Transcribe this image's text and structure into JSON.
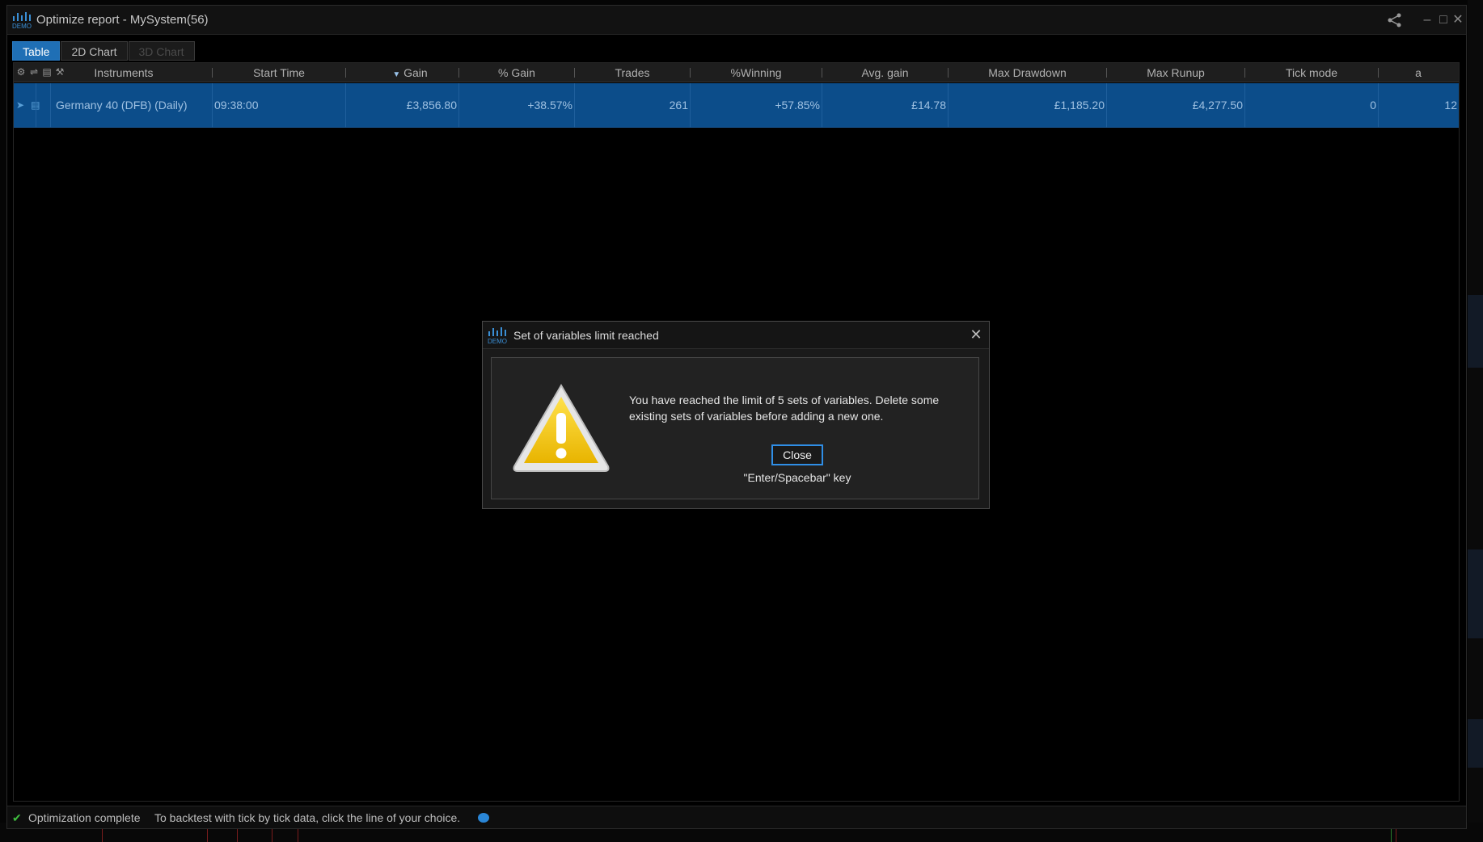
{
  "window": {
    "title": "Optimize report - MySystem(56)",
    "logo_text": "DEMO"
  },
  "tabs": [
    {
      "label": "Table",
      "state": "active"
    },
    {
      "label": "2D Chart",
      "state": "normal"
    },
    {
      "label": "3D Chart",
      "state": "disabled"
    }
  ],
  "table": {
    "columns": [
      "Instruments",
      "Start Time",
      "Gain",
      "% Gain",
      "Trades",
      "%Winning",
      "Avg. gain",
      "Max Drawdown",
      "Max Runup",
      "Tick mode",
      "a"
    ],
    "sort_column": "Gain",
    "rows": [
      {
        "instrument": "Germany 40 (DFB) (Daily)",
        "start_time": "09:38:00",
        "gain": "£3,856.80",
        "pct_gain": "+38.57%",
        "trades": "261",
        "pct_winning": "+57.85%",
        "avg_gain": "£14.78",
        "max_drawdown": "£1,185.20",
        "max_runup": "£4,277.50",
        "tick_mode": "0",
        "a": "12"
      }
    ]
  },
  "status": {
    "text": "Optimization complete",
    "hint": "To backtest with tick by tick data, click the line of your choice."
  },
  "dialog": {
    "title": "Set of variables limit reached",
    "message": "You have reached the limit of 5 sets of variables. Delete some existing sets of variables before adding a new one.",
    "button_label": "Close",
    "key_hint": "\"Enter/Spacebar\" key"
  },
  "colors": {
    "accent": "#1f6fb5",
    "selected_row": "#0c4d8a",
    "warning": "#f2c21a",
    "success": "#3fbf3f"
  }
}
